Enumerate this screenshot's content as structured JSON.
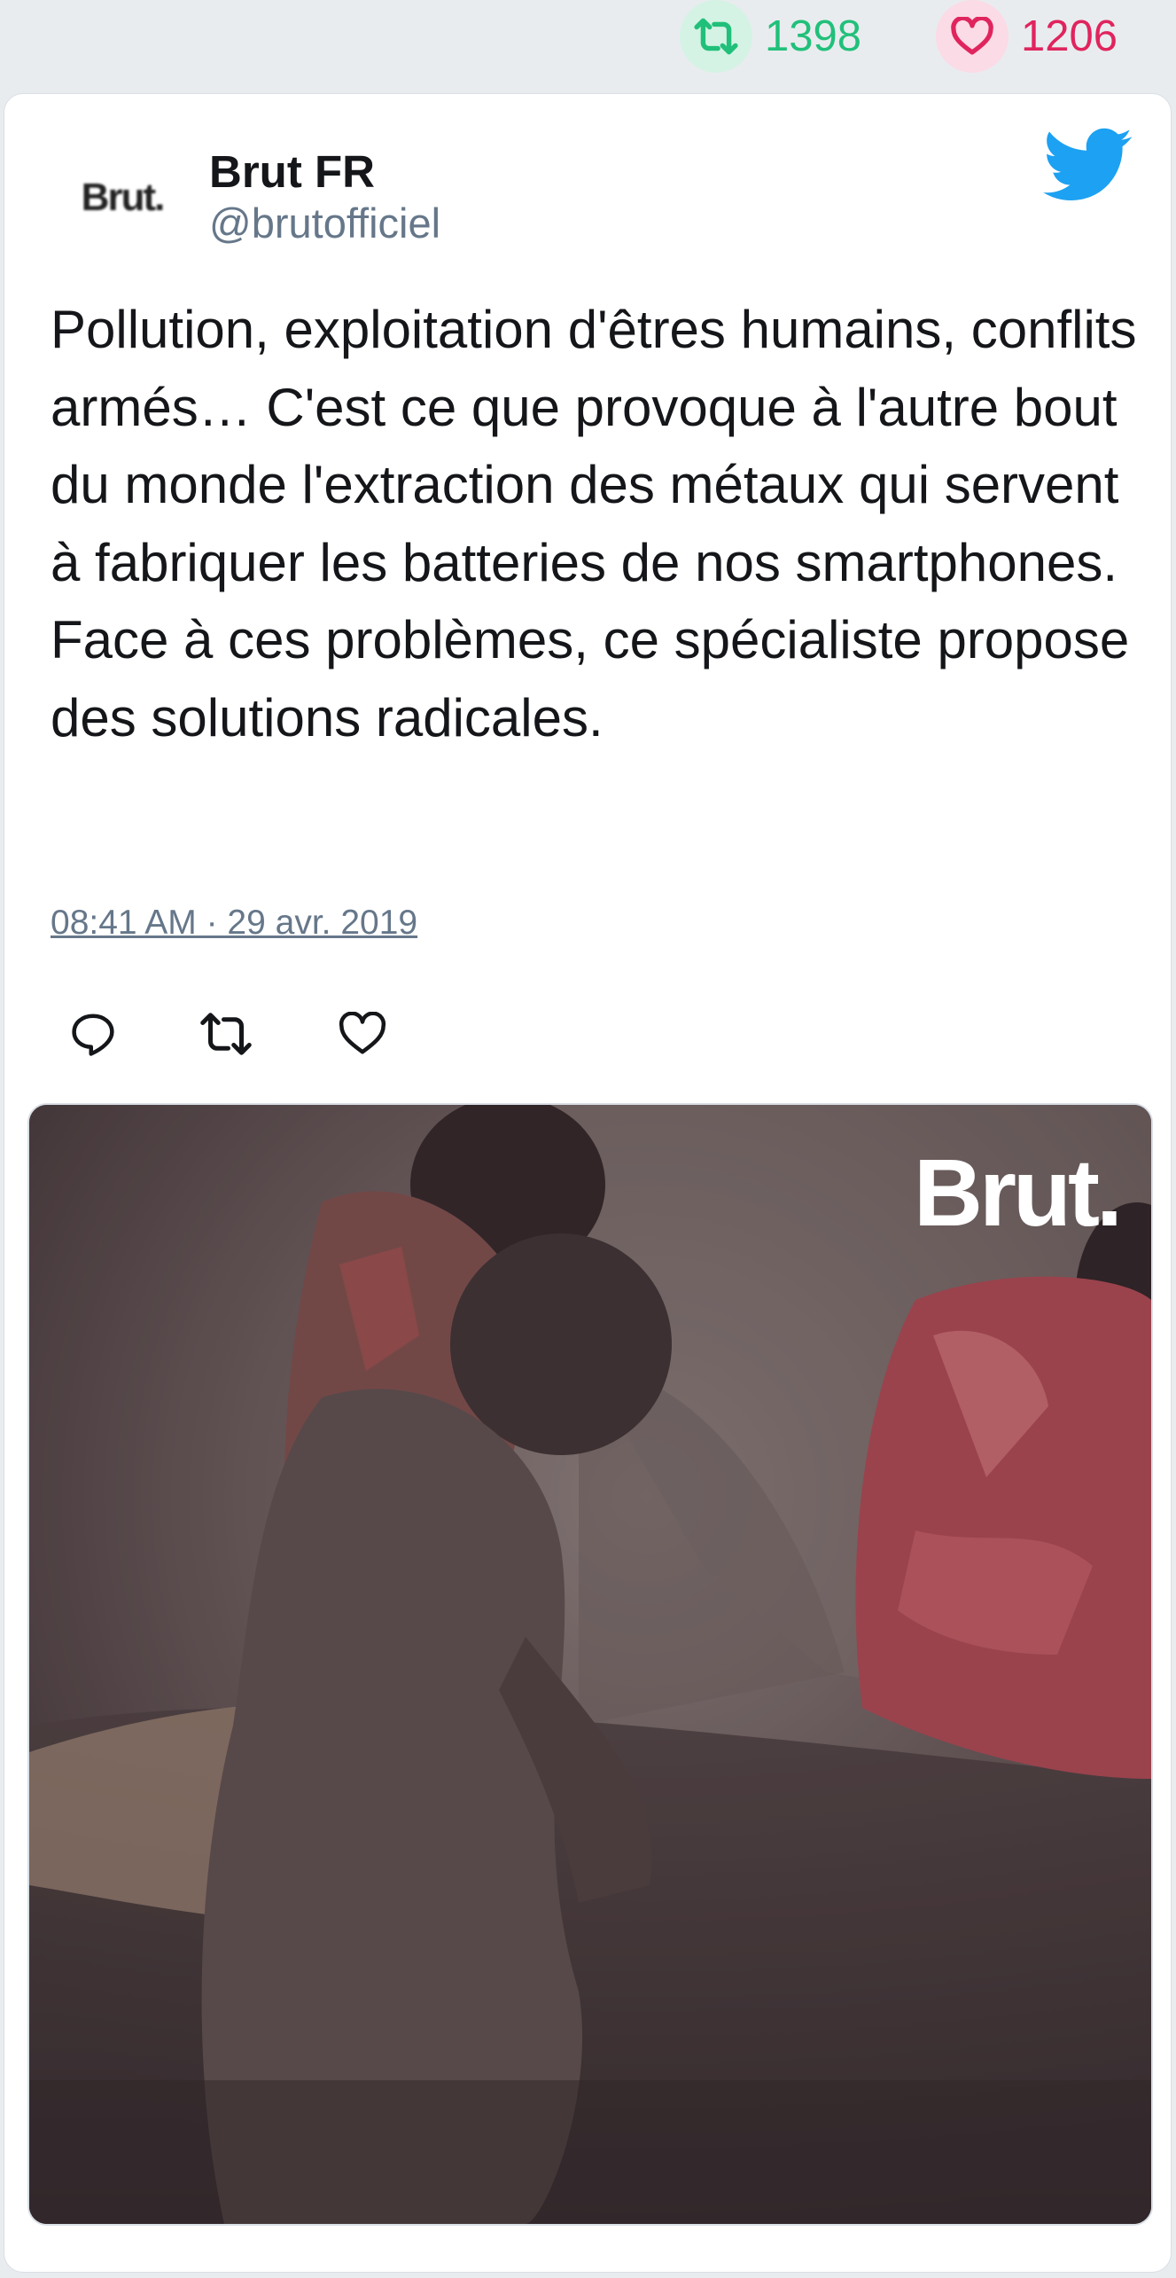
{
  "stats": {
    "retweet_count": "1398",
    "like_count": "1206",
    "retweet_color": "#21c07a",
    "like_color": "#e0245e",
    "retweet_icon": "retweet-icon",
    "like_icon": "heart-icon"
  },
  "tweet": {
    "author_name": "Brut FR",
    "author_handle": "@brutofficiel",
    "avatar_text": "Brut.",
    "brand_icon": "twitter-bird-icon",
    "text": "Pollution, exploitation d'êtres humains, conflits armés… C'est ce que provoque à l'autre bout du monde l'extraction des métaux qui servent à fabriquer les batteries de nos smartphones. Face à ces problèmes, ce spécialiste propose des solutions radicales.",
    "timestamp": "08:41 AM · 29 avr. 2019",
    "actions": [
      "reply-icon",
      "retweet-icon",
      "like-icon"
    ],
    "accent_color": "#1da1f2"
  },
  "media": {
    "watermark": "Brut.",
    "description_icon": "video-thumbnail"
  }
}
